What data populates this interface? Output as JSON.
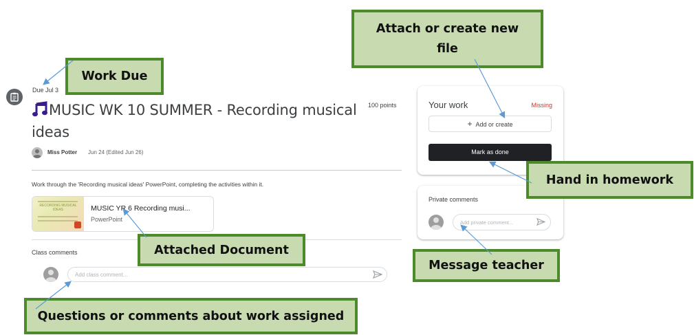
{
  "assignment": {
    "due": "Due Jul 3",
    "title": "MUSIC WK 10 SUMMER - Recording musical ideas",
    "points": "100 points",
    "teacher": "Miss Potter",
    "posted": "Jun 24 (Edited Jun 26)",
    "instructions": "Work through the 'Recording musical ideas' PowerPoint, completing the activities within it.",
    "icon": "assignment-icon",
    "title_icon": "music-note-icon"
  },
  "attachment": {
    "name": "MUSIC YR 6 Recording musi...",
    "type": "PowerPoint",
    "thumbnail_text": "RECORDING MUSICAL IDEAS"
  },
  "class_comments": {
    "label": "Class comments",
    "placeholder": "Add class comment..."
  },
  "your_work": {
    "title": "Your work",
    "status": "Missing",
    "add_label": "Add or create",
    "mark_done_label": "Mark as done"
  },
  "private_comments": {
    "label": "Private comments",
    "placeholder": "Add private comment..."
  },
  "callouts": {
    "work_due": "Work Due",
    "attach_create": "Attach or create new file",
    "hand_in": "Hand in homework",
    "attached_doc": "Attached Document",
    "message_teacher": "Message teacher",
    "questions": "Questions or comments about work assigned"
  },
  "colors": {
    "missing": "#d93025",
    "callout_fill": "#c8dbb0",
    "callout_border": "#4d8a2c",
    "arrow": "#5b9bd5",
    "mark_button": "#202124"
  }
}
